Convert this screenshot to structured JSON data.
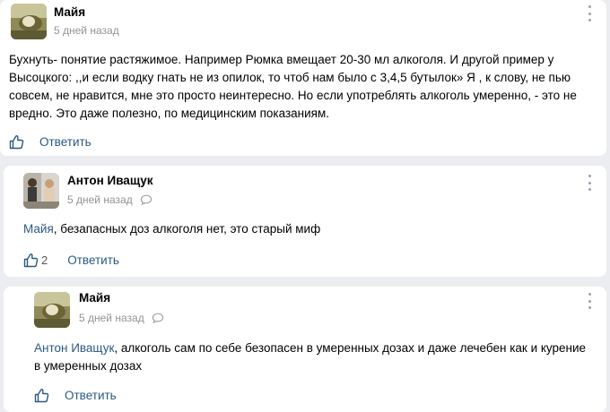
{
  "comments": [
    {
      "author": "Майя",
      "time": "5 дней назад",
      "text": "Бухнуть- понятие растяжимое. Например Рюмка вмещает 20-30 мл алкоголя. И другой пример у Высоцкого: ,,и если водку гнать не из опилок, то чтоб нам было с 3,4,5 бутылок» Я , к слову, не пью совсем, не нравится, мне это просто неинтересно. Но если употреблять алкоголь умеренно, - это не вредно. Это даже полезно, по медицинским показаниям.",
      "likes": "",
      "reply_label": "Ответить"
    },
    {
      "author": "Антон Иващук",
      "time": "5 дней назад",
      "mention": "Майя",
      "text": ", безапасных доз алкоголя нет, это старый миф",
      "likes": "2",
      "reply_label": "Ответить"
    },
    {
      "author": "Майя",
      "time": "5 дней назад",
      "mention": "Антон Иващук",
      "text": ", алкоголь сам по себе безопасен в умеренных дозах и даже лечебен как и курение в умеренных дозах",
      "likes": "",
      "reply_label": "Ответить"
    }
  ],
  "colors": {
    "link": "#2a5885",
    "meta": "#939393",
    "background": "#ebedf0"
  }
}
